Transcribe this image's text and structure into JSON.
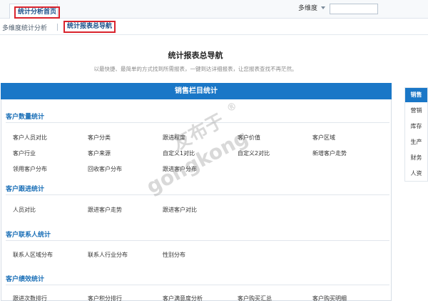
{
  "topbar": {
    "home_tab": "统计分析首页",
    "dimension_select": "多维度",
    "search_placeholder": ""
  },
  "subnav": {
    "items": [
      "多维度统计分析",
      "统计报表总导航"
    ]
  },
  "header": {
    "title": "统计报表总导航",
    "subtitle": "以最快捷、最简单的方式找到所需报表，一键到达详细报表，让您报表查找不再茫然。"
  },
  "banner": "销售栏目统计",
  "sections": [
    {
      "title": "客户数量统计",
      "rows": [
        [
          "客户人员对比",
          "客户分类",
          "跟进程度",
          "客户价值",
          "客户区域"
        ],
        [
          "客户行业",
          "客户来源",
          "自定义1对比",
          "自定义2对比",
          "新增客户走势"
        ],
        [
          "领用客户分布",
          "回收客户分布",
          "跟进客户分布"
        ]
      ]
    },
    {
      "title": "客户跟进统计",
      "rows": [
        [
          "人员对比",
          "跟进客户走势",
          "跟进客户对比"
        ]
      ]
    },
    {
      "title": "客户联系人统计",
      "rows": [
        [
          "联系人区域分布",
          "联系人行业分布",
          "性别分布"
        ]
      ]
    },
    {
      "title": "客户绩效统计",
      "rows": [
        [
          "跟进次数排行",
          "客户积分排行",
          "客户满意度分析",
          "客户购买汇总",
          "客户购买明细"
        ]
      ]
    }
  ],
  "sidebar": {
    "items": [
      "销售",
      "营销",
      "库存",
      "生产",
      "财务",
      "人资"
    ],
    "active_index": 0
  },
  "watermark": {
    "line1": "友布于",
    "line2": "gongkong",
    "mark": "®"
  },
  "colors": {
    "brand_blue": "#1a77c7",
    "section_title": "#1a6fb7",
    "highlight_red": "#d9232d"
  }
}
